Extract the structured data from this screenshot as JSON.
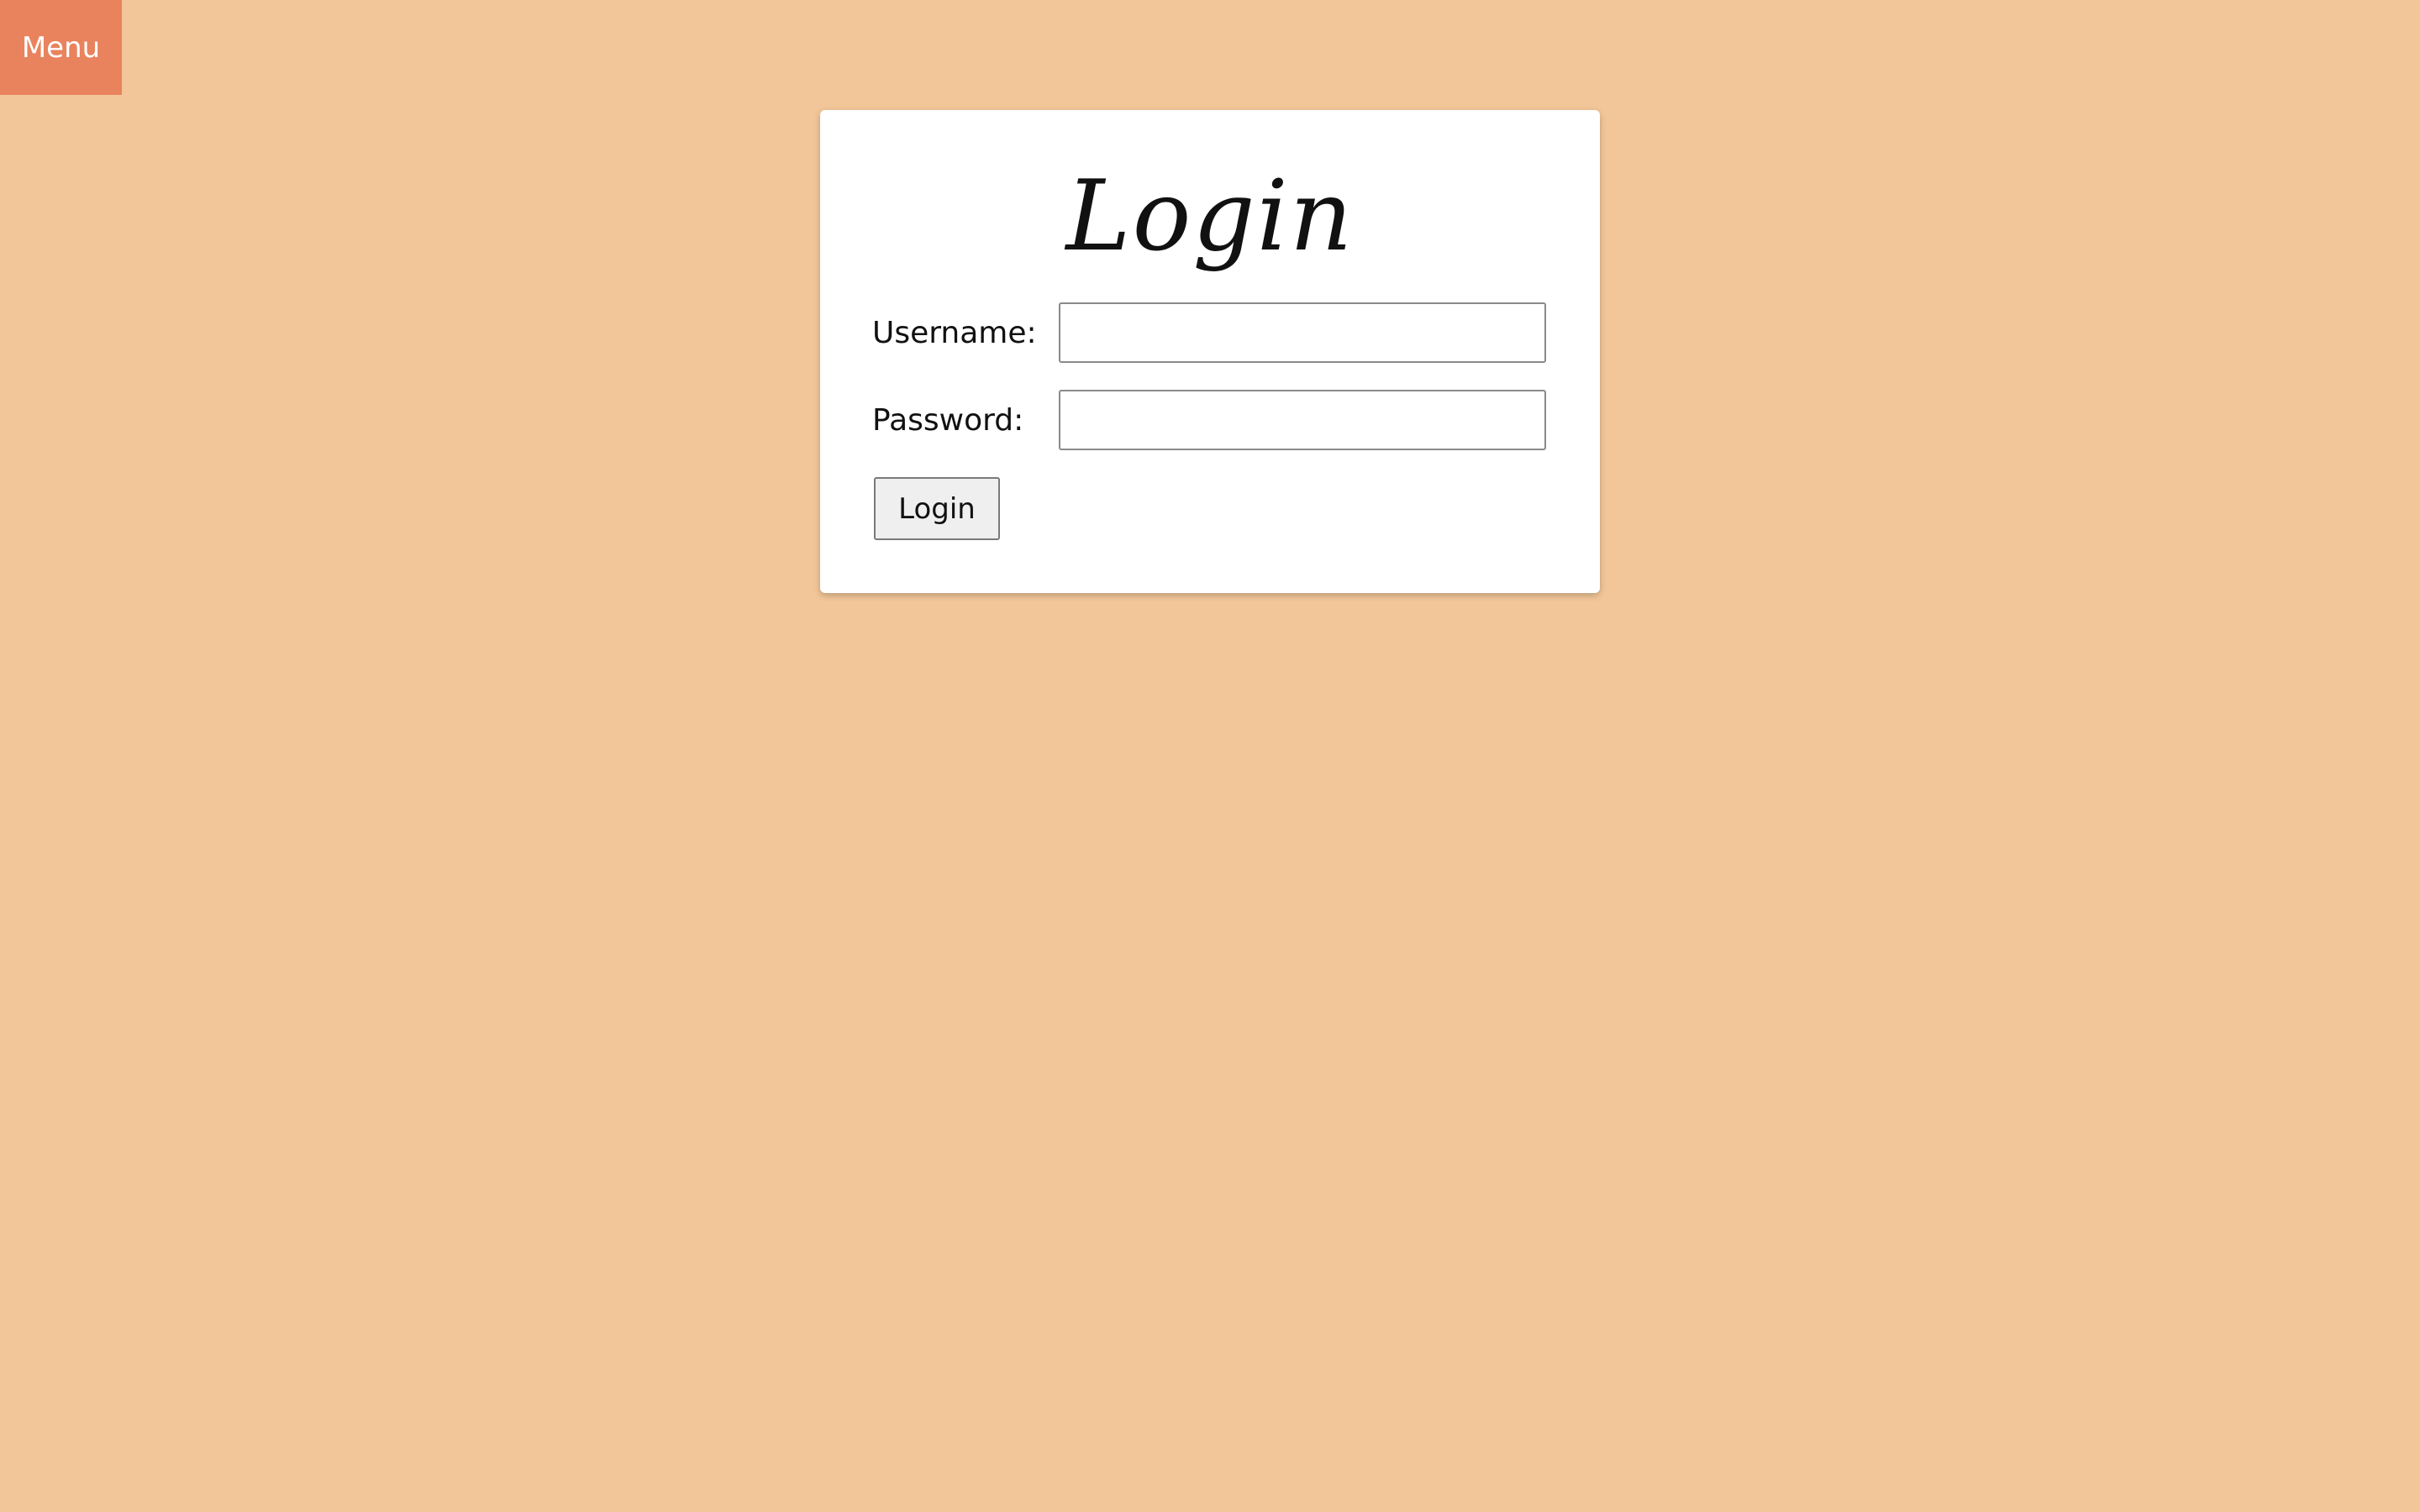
{
  "nav": {
    "menu_label": "Menu"
  },
  "login_form": {
    "title": "Login",
    "username_label": "Username:",
    "username_value": "",
    "password_label": "Password:",
    "password_value": "",
    "submit_label": "Login"
  },
  "colors": {
    "background": "#f2c698",
    "menu_background": "#e8835e",
    "card_background": "#ffffff"
  }
}
